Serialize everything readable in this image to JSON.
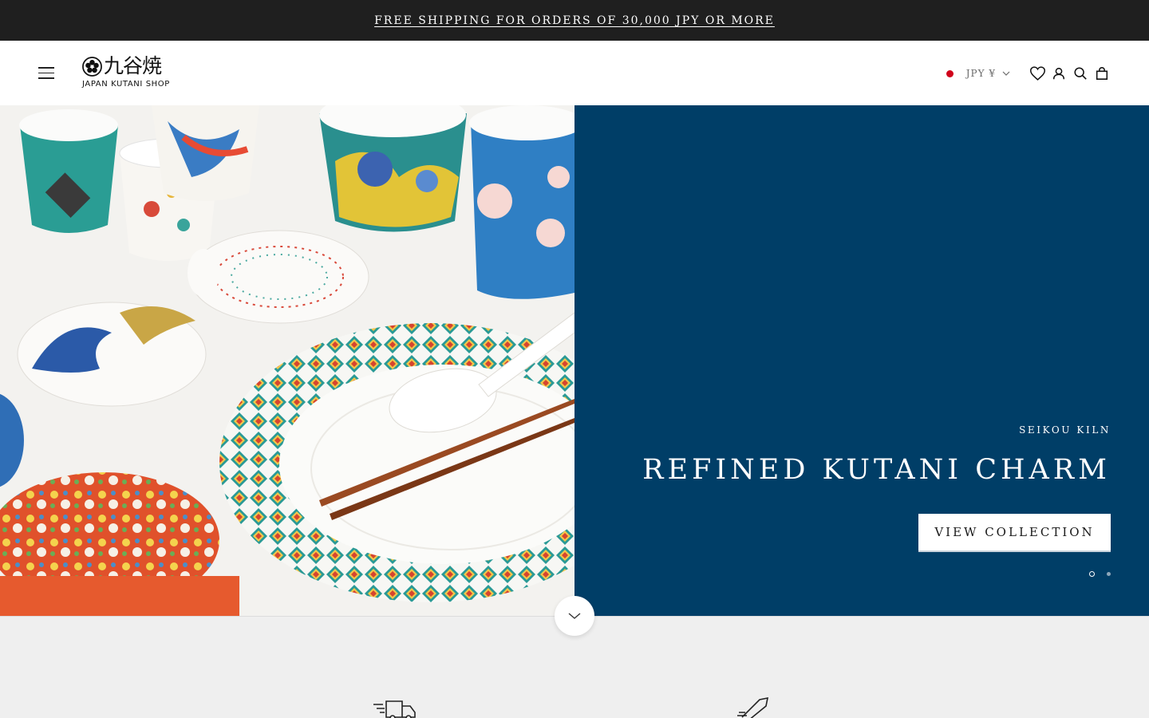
{
  "announcement": {
    "text": "FREE SHIPPING FOR ORDERS OF 30,000 JPY OR MORE"
  },
  "header": {
    "logo": {
      "kanji": "九谷焼",
      "subtitle": "JAPAN KUTANI SHOP"
    },
    "currency": {
      "label": "JPY ¥",
      "flag_color": "#d0021b"
    },
    "icons": [
      "menu-icon",
      "wishlist-icon",
      "account-icon",
      "search-icon",
      "cart-icon"
    ]
  },
  "hero": {
    "kicker": "SEIKOU KILN",
    "title": "REFINED KUTANI CHARM",
    "cta_label": "VIEW COLLECTION",
    "panel_color": "#003e67",
    "slides_total": 2,
    "active_slide": 1
  },
  "features": {
    "icons": [
      "delivery-truck-icon",
      "rocket-icon"
    ]
  },
  "colors": {
    "announcement_bg": "#1f1f1f",
    "features_bg": "#efefef"
  }
}
